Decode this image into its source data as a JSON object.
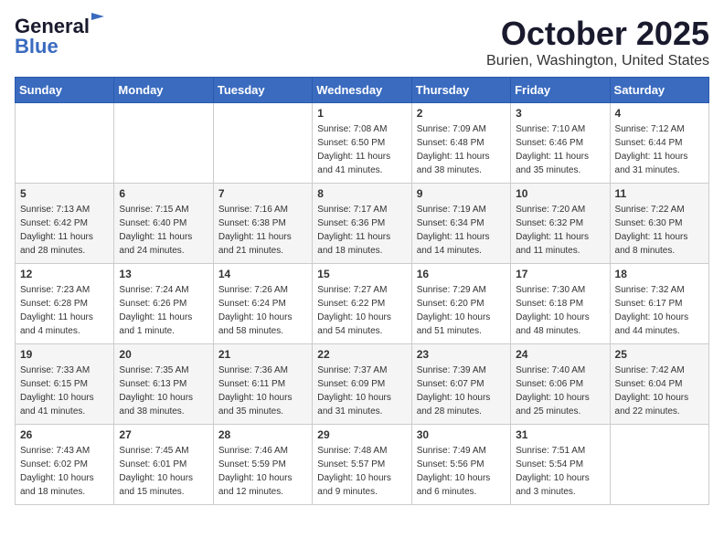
{
  "header": {
    "logo_line1": "General",
    "logo_line2": "Blue",
    "month": "October 2025",
    "location": "Burien, Washington, United States"
  },
  "weekdays": [
    "Sunday",
    "Monday",
    "Tuesday",
    "Wednesday",
    "Thursday",
    "Friday",
    "Saturday"
  ],
  "weeks": [
    [
      {
        "day": "",
        "sunrise": "",
        "sunset": "",
        "daylight": ""
      },
      {
        "day": "",
        "sunrise": "",
        "sunset": "",
        "daylight": ""
      },
      {
        "day": "",
        "sunrise": "",
        "sunset": "",
        "daylight": ""
      },
      {
        "day": "1",
        "sunrise": "Sunrise: 7:08 AM",
        "sunset": "Sunset: 6:50 PM",
        "daylight": "Daylight: 11 hours and 41 minutes."
      },
      {
        "day": "2",
        "sunrise": "Sunrise: 7:09 AM",
        "sunset": "Sunset: 6:48 PM",
        "daylight": "Daylight: 11 hours and 38 minutes."
      },
      {
        "day": "3",
        "sunrise": "Sunrise: 7:10 AM",
        "sunset": "Sunset: 6:46 PM",
        "daylight": "Daylight: 11 hours and 35 minutes."
      },
      {
        "day": "4",
        "sunrise": "Sunrise: 7:12 AM",
        "sunset": "Sunset: 6:44 PM",
        "daylight": "Daylight: 11 hours and 31 minutes."
      }
    ],
    [
      {
        "day": "5",
        "sunrise": "Sunrise: 7:13 AM",
        "sunset": "Sunset: 6:42 PM",
        "daylight": "Daylight: 11 hours and 28 minutes."
      },
      {
        "day": "6",
        "sunrise": "Sunrise: 7:15 AM",
        "sunset": "Sunset: 6:40 PM",
        "daylight": "Daylight: 11 hours and 24 minutes."
      },
      {
        "day": "7",
        "sunrise": "Sunrise: 7:16 AM",
        "sunset": "Sunset: 6:38 PM",
        "daylight": "Daylight: 11 hours and 21 minutes."
      },
      {
        "day": "8",
        "sunrise": "Sunrise: 7:17 AM",
        "sunset": "Sunset: 6:36 PM",
        "daylight": "Daylight: 11 hours and 18 minutes."
      },
      {
        "day": "9",
        "sunrise": "Sunrise: 7:19 AM",
        "sunset": "Sunset: 6:34 PM",
        "daylight": "Daylight: 11 hours and 14 minutes."
      },
      {
        "day": "10",
        "sunrise": "Sunrise: 7:20 AM",
        "sunset": "Sunset: 6:32 PM",
        "daylight": "Daylight: 11 hours and 11 minutes."
      },
      {
        "day": "11",
        "sunrise": "Sunrise: 7:22 AM",
        "sunset": "Sunset: 6:30 PM",
        "daylight": "Daylight: 11 hours and 8 minutes."
      }
    ],
    [
      {
        "day": "12",
        "sunrise": "Sunrise: 7:23 AM",
        "sunset": "Sunset: 6:28 PM",
        "daylight": "Daylight: 11 hours and 4 minutes."
      },
      {
        "day": "13",
        "sunrise": "Sunrise: 7:24 AM",
        "sunset": "Sunset: 6:26 PM",
        "daylight": "Daylight: 11 hours and 1 minute."
      },
      {
        "day": "14",
        "sunrise": "Sunrise: 7:26 AM",
        "sunset": "Sunset: 6:24 PM",
        "daylight": "Daylight: 10 hours and 58 minutes."
      },
      {
        "day": "15",
        "sunrise": "Sunrise: 7:27 AM",
        "sunset": "Sunset: 6:22 PM",
        "daylight": "Daylight: 10 hours and 54 minutes."
      },
      {
        "day": "16",
        "sunrise": "Sunrise: 7:29 AM",
        "sunset": "Sunset: 6:20 PM",
        "daylight": "Daylight: 10 hours and 51 minutes."
      },
      {
        "day": "17",
        "sunrise": "Sunrise: 7:30 AM",
        "sunset": "Sunset: 6:18 PM",
        "daylight": "Daylight: 10 hours and 48 minutes."
      },
      {
        "day": "18",
        "sunrise": "Sunrise: 7:32 AM",
        "sunset": "Sunset: 6:17 PM",
        "daylight": "Daylight: 10 hours and 44 minutes."
      }
    ],
    [
      {
        "day": "19",
        "sunrise": "Sunrise: 7:33 AM",
        "sunset": "Sunset: 6:15 PM",
        "daylight": "Daylight: 10 hours and 41 minutes."
      },
      {
        "day": "20",
        "sunrise": "Sunrise: 7:35 AM",
        "sunset": "Sunset: 6:13 PM",
        "daylight": "Daylight: 10 hours and 38 minutes."
      },
      {
        "day": "21",
        "sunrise": "Sunrise: 7:36 AM",
        "sunset": "Sunset: 6:11 PM",
        "daylight": "Daylight: 10 hours and 35 minutes."
      },
      {
        "day": "22",
        "sunrise": "Sunrise: 7:37 AM",
        "sunset": "Sunset: 6:09 PM",
        "daylight": "Daylight: 10 hours and 31 minutes."
      },
      {
        "day": "23",
        "sunrise": "Sunrise: 7:39 AM",
        "sunset": "Sunset: 6:07 PM",
        "daylight": "Daylight: 10 hours and 28 minutes."
      },
      {
        "day": "24",
        "sunrise": "Sunrise: 7:40 AM",
        "sunset": "Sunset: 6:06 PM",
        "daylight": "Daylight: 10 hours and 25 minutes."
      },
      {
        "day": "25",
        "sunrise": "Sunrise: 7:42 AM",
        "sunset": "Sunset: 6:04 PM",
        "daylight": "Daylight: 10 hours and 22 minutes."
      }
    ],
    [
      {
        "day": "26",
        "sunrise": "Sunrise: 7:43 AM",
        "sunset": "Sunset: 6:02 PM",
        "daylight": "Daylight: 10 hours and 18 minutes."
      },
      {
        "day": "27",
        "sunrise": "Sunrise: 7:45 AM",
        "sunset": "Sunset: 6:01 PM",
        "daylight": "Daylight: 10 hours and 15 minutes."
      },
      {
        "day": "28",
        "sunrise": "Sunrise: 7:46 AM",
        "sunset": "Sunset: 5:59 PM",
        "daylight": "Daylight: 10 hours and 12 minutes."
      },
      {
        "day": "29",
        "sunrise": "Sunrise: 7:48 AM",
        "sunset": "Sunset: 5:57 PM",
        "daylight": "Daylight: 10 hours and 9 minutes."
      },
      {
        "day": "30",
        "sunrise": "Sunrise: 7:49 AM",
        "sunset": "Sunset: 5:56 PM",
        "daylight": "Daylight: 10 hours and 6 minutes."
      },
      {
        "day": "31",
        "sunrise": "Sunrise: 7:51 AM",
        "sunset": "Sunset: 5:54 PM",
        "daylight": "Daylight: 10 hours and 3 minutes."
      },
      {
        "day": "",
        "sunrise": "",
        "sunset": "",
        "daylight": ""
      }
    ]
  ]
}
